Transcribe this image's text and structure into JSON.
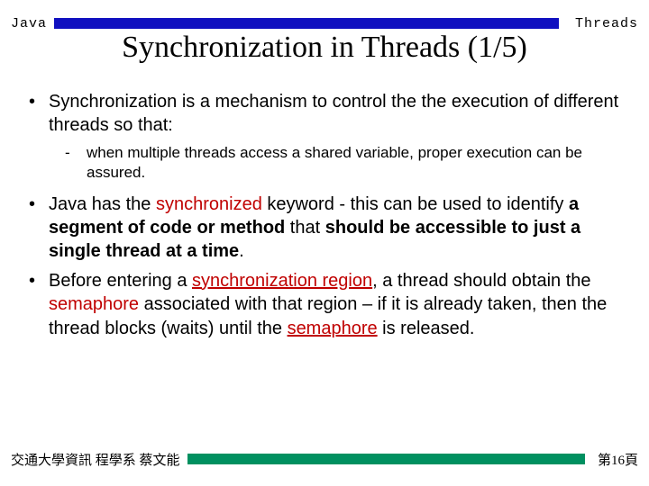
{
  "header": {
    "left": "Java",
    "right": "Threads"
  },
  "title": "Synchronization in Threads (1/5)",
  "bullets": [
    {
      "text": "Synchronization is a mechanism to control the the execution of different threads so that:",
      "sub": [
        "when multiple threads access a shared variable, proper execution can be assured."
      ]
    },
    {
      "seg": [
        "Java has the ",
        "synchronized",
        " keyword - this can be used to identify ",
        "a segment of code or method",
        " that ",
        "should be accessible to just a single thread at a time",
        "."
      ]
    },
    {
      "seg": [
        "Before entering a ",
        "synchronization region",
        ", a thread should obtain the ",
        "semaphore",
        " associated with that region – if it is already taken, then the thread blocks (waits) until the ",
        "semaphore",
        " is released."
      ]
    }
  ],
  "footer": {
    "left": "交通大學資訊 程學系 蔡文能",
    "right": "第16頁"
  },
  "colors": {
    "header_bar": "#1010c0",
    "footer_bar": "#009060",
    "emphasis": "#c00000"
  }
}
